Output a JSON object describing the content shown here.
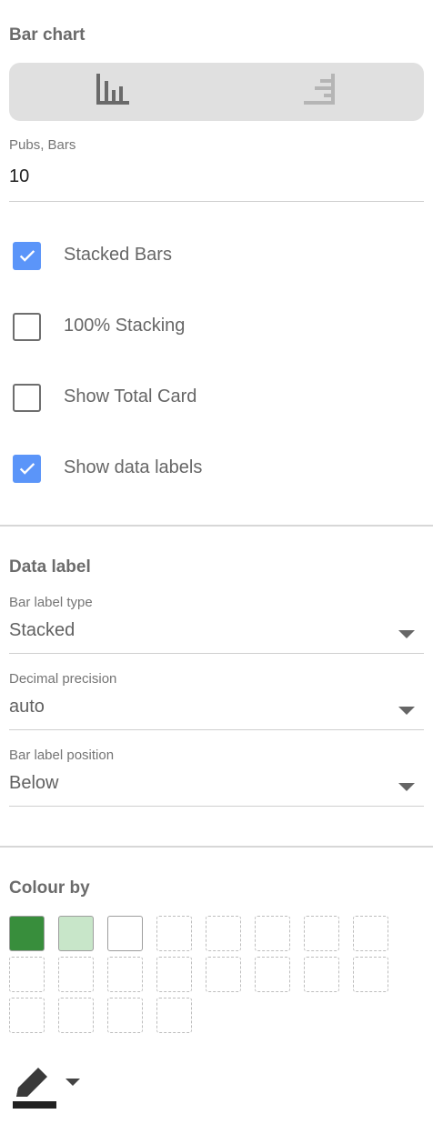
{
  "bar_chart": {
    "title": "Bar chart",
    "orientation": {
      "options": [
        "vertical-bars-icon",
        "horizontal-bars-icon"
      ],
      "selected": "vertical-bars-icon"
    },
    "bars_field": {
      "label": "Pubs, Bars",
      "value": "10"
    },
    "checkboxes": [
      {
        "label": "Stacked Bars",
        "checked": true
      },
      {
        "label": "100% Stacking",
        "checked": false
      },
      {
        "label": "Show Total Card",
        "checked": false
      },
      {
        "label": "Show data labels",
        "checked": true
      }
    ]
  },
  "data_label": {
    "title": "Data label",
    "dropdowns": [
      {
        "label": "Bar label type",
        "value": "Stacked"
      },
      {
        "label": "Decimal precision",
        "value": "auto"
      },
      {
        "label": "Bar label position",
        "value": "Below"
      }
    ]
  },
  "colour_by": {
    "title": "Colour by",
    "swatches": [
      "#388e3c",
      "#c8e6c9",
      "#ffffff"
    ],
    "empty_slots": 17,
    "pencil_colour": "#212121"
  },
  "colors": {
    "accent": "#5b95f9",
    "toggle_bg": "#e0e0e0"
  }
}
